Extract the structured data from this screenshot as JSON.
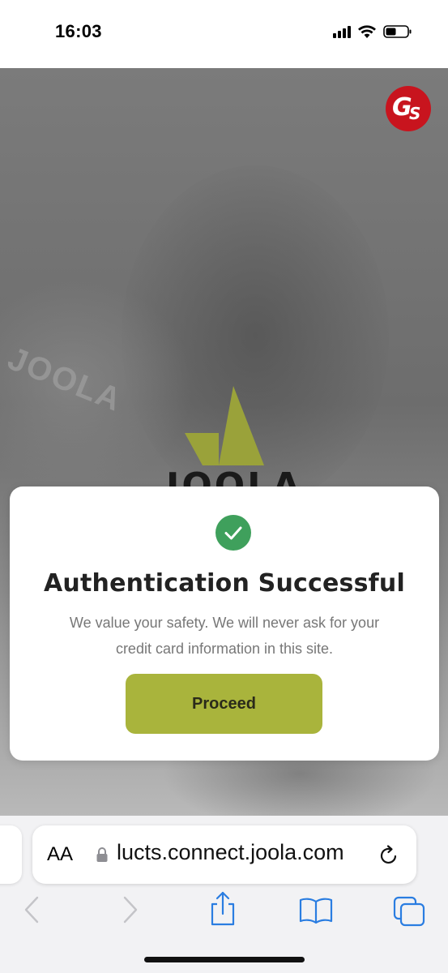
{
  "status_bar": {
    "time": "16:03",
    "icons": [
      "cellular-signal-icon",
      "wifi-icon",
      "battery-icon"
    ]
  },
  "page": {
    "badge": {
      "letter_g": "G",
      "letter_s": "S"
    },
    "brand_logo_text": "JOOLA",
    "background_jersey_text": "JOOLA"
  },
  "modal": {
    "icon": "check-circle-icon",
    "title": "Authentication Successful",
    "message": "We value your safety. We will never ask for your credit card information in this site.",
    "proceed_label": "Proceed"
  },
  "browser": {
    "text_size_label": "AA",
    "url": "lucts.connect.joola.com",
    "toolbar_icons": [
      "back-icon",
      "forward-icon",
      "share-icon",
      "bookmarks-icon",
      "tabs-icon"
    ]
  },
  "colors": {
    "accent": "#a9b43c",
    "success": "#3fa05c",
    "badge_red": "#c8141e",
    "ios_blue": "#2a7de1"
  }
}
